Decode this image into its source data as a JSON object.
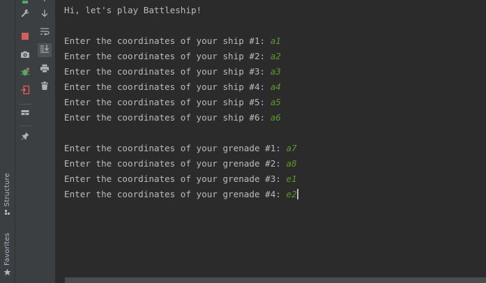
{
  "side_tabs": [
    {
      "label": "Structure",
      "icon": "structure-icon"
    },
    {
      "label": "Favorites",
      "icon": "star-icon"
    }
  ],
  "toolbar_left": [
    {
      "name": "wrench-icon",
      "label": "Settings"
    },
    {
      "name": "stop-icon",
      "label": "Stop"
    },
    {
      "name": "camera-icon",
      "label": "Dump threads"
    },
    {
      "name": "bug-icon",
      "label": "Debug"
    },
    {
      "name": "exit-icon",
      "label": "Exit"
    },
    {
      "name": "layout-icon",
      "label": "Restore layout"
    },
    {
      "name": "pin-icon",
      "label": "Pin tab"
    }
  ],
  "toolbar_right": [
    {
      "name": "arrow-down-icon",
      "label": "Down"
    },
    {
      "name": "soft-wrap-icon",
      "label": "Soft-wrap"
    },
    {
      "name": "scroll-to-end-icon",
      "label": "Scroll to the end",
      "active": true
    },
    {
      "name": "print-icon",
      "label": "Print"
    },
    {
      "name": "trash-icon",
      "label": "Clear all"
    }
  ],
  "console": {
    "greeting": "Hi, let's play Battleship!",
    "ship_prompts": [
      {
        "prompt": "Enter the coordinates of your ship #1: ",
        "input": "a1"
      },
      {
        "prompt": "Enter the coordinates of your ship #2: ",
        "input": "a2"
      },
      {
        "prompt": "Enter the coordinates of your ship #3: ",
        "input": "a3"
      },
      {
        "prompt": "Enter the coordinates of your ship #4: ",
        "input": "a4"
      },
      {
        "prompt": "Enter the coordinates of your ship #5: ",
        "input": "a5"
      },
      {
        "prompt": "Enter the coordinates of your ship #6: ",
        "input": "a6"
      }
    ],
    "grenade_prompts": [
      {
        "prompt": "Enter the coordinates of your grenade #1: ",
        "input": "a7"
      },
      {
        "prompt": "Enter the coordinates of your grenade #2: ",
        "input": "a8"
      },
      {
        "prompt": "Enter the coordinates of your grenade #3: ",
        "input": "e1"
      },
      {
        "prompt": "Enter the coordinates of your grenade #4: ",
        "input": "e2"
      }
    ]
  },
  "colors": {
    "background": "#2b2b2b",
    "toolbar": "#3c3f41",
    "text": "#bbbbbb",
    "user_input": "#5a9a28",
    "stop_red": "#db5c5c",
    "icon_green": "#59a869"
  }
}
